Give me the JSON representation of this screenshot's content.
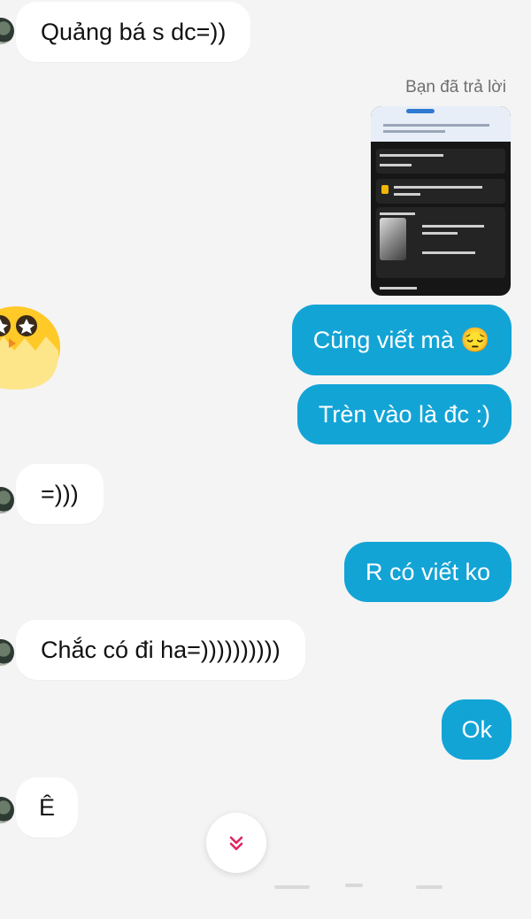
{
  "messages": {
    "m1": "Quảng bá s dc=))",
    "reply_label": "Bạn đã trả lời",
    "m2": "Cũng viết mà 😔",
    "m3": "Trèn vào là đc :)",
    "m4": "=)))",
    "m5": "R có viết ko",
    "m6": "Chắc có đi ha=))))))))))",
    "m7": "Ok",
    "m8": "Ê"
  },
  "colors": {
    "outgoing_bubble": "#13a4d6",
    "incoming_bubble": "#ffffff",
    "background": "#f4f4f4",
    "scroll_icon": "#e0245e"
  },
  "scroll_button": {
    "icon": "double-chevron-down-icon",
    "glyph": "⌄⌄"
  }
}
